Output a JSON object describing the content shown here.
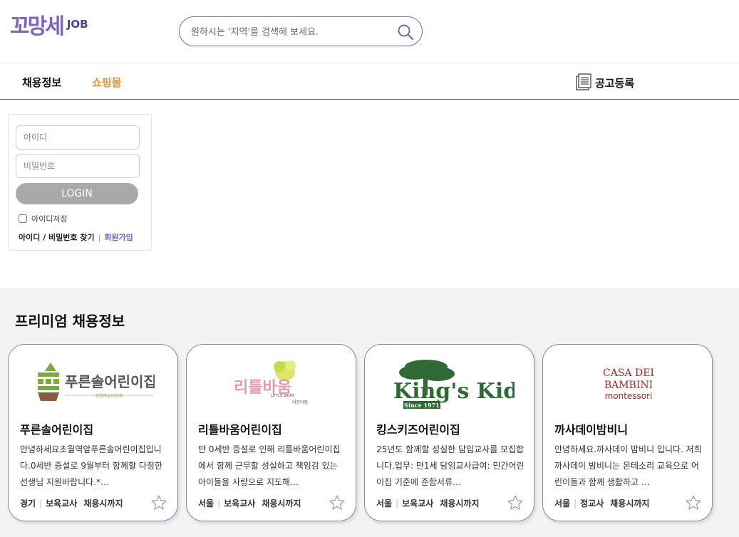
{
  "header": {
    "logo_text": "꼬망세",
    "logo_sub": "JOB",
    "search_placeholder": "원하시는 '지역'을 검색해 보세요."
  },
  "nav": {
    "jobs": "채용정보",
    "shop": "쇼핑몰",
    "post": "공고등록"
  },
  "login": {
    "id_placeholder": "아이디",
    "pw_placeholder": "비밀번호",
    "button": "LOGIN",
    "save_id": "아이디저장",
    "find": "아이디 / 비밀번호 찾기",
    "join": "회원가입"
  },
  "premium": {
    "title": "프리미엄 채용정보",
    "cards": [
      {
        "logo": {
          "name": "푸른솔어린이집",
          "tagline": "자연속유아교육"
        },
        "title": "푸른솔어린이집",
        "desc": "안녕하세요초월역앞푸른솔어린이집입니다.0세반 증설로 9월부터 함께할 다정한 선생님 지원바랍니다.*…",
        "region": "경기",
        "role": "보육교사",
        "period": "채용시까지"
      },
      {
        "logo": {
          "name": "리틀바움",
          "tagline": "LITTLE BAUM",
          "sub": "어린이집"
        },
        "title": "리틀바움어린이집",
        "desc": "만 0세반 증설로 인해 리틀바움어린이집에서 함께 근무할 성실하고 책임감 있는 아이들을 사랑으로 지도해…",
        "region": "서울",
        "role": "보육교사",
        "period": "채용시까지"
      },
      {
        "logo": {
          "name": "King's Kids",
          "tagline": "Since 1971"
        },
        "title": "킹스키즈어린이집",
        "desc": "25년도 함께할 성실한 담임교사를 모집합니다.업무: 만1세 담임교사급여: 민간어린이집 기준에 준함서류…",
        "region": "서울",
        "role": "보육교사",
        "period": "채용시까지"
      },
      {
        "logo": {
          "line1": "CASA DEI",
          "line2": "BAMBINI",
          "line3": "montessori"
        },
        "title": "까사데이밤비니",
        "desc": "안녕하세요.까사데이 밤비니 입니다. 저희 까사데이 밤비니는 몬테소리 교육으로 어린이들과 함께 생활하고 …",
        "region": "서울",
        "role": "정교사",
        "period": "채용시까지"
      }
    ]
  },
  "colors": {
    "brand_purple": "#7b63c4",
    "shop_orange": "#e8933a",
    "login_button": "#a9a9a9",
    "section_bg": "#f3f3f3",
    "kingskids_green": "#2e6b34",
    "casa_red": "#9a2a2a"
  },
  "icons": {
    "search": "magnifier-icon",
    "post": "document-list-icon",
    "favorite": "star-outline-icon"
  }
}
